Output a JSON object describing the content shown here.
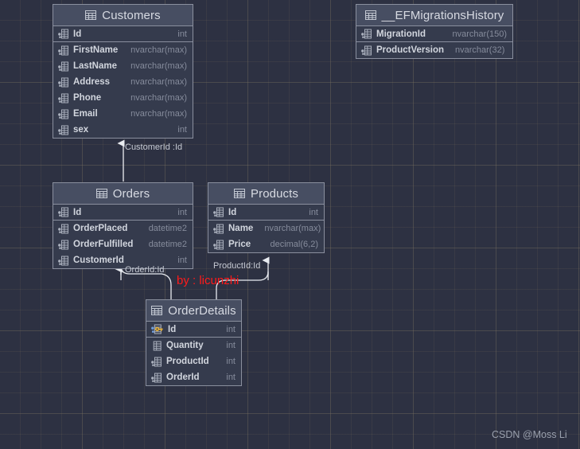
{
  "diagram": {
    "background_color": "#2d3142",
    "table_header_color": "#474e62",
    "table_body_color": "#353b4d",
    "border_color": "#8a8f9e",
    "accent_key_color": "#e8b339"
  },
  "tables": [
    {
      "id": "customers",
      "name": "Customers",
      "icon": "table-icon",
      "columns": [
        {
          "name": "Id",
          "type": "int",
          "icon": "column-icon",
          "primary": false
        },
        {
          "name": "FirstName",
          "type": "nvarchar(max)",
          "icon": "column-icon",
          "primary": false
        },
        {
          "name": "LastName",
          "type": "nvarchar(max)",
          "icon": "column-icon",
          "primary": false
        },
        {
          "name": "Address",
          "type": "nvarchar(max)",
          "icon": "column-icon",
          "primary": false
        },
        {
          "name": "Phone",
          "type": "nvarchar(max)",
          "icon": "column-icon",
          "primary": false
        },
        {
          "name": "Email",
          "type": "nvarchar(max)",
          "icon": "column-icon",
          "primary": false
        },
        {
          "name": "sex",
          "type": "int",
          "icon": "column-icon",
          "primary": false
        }
      ]
    },
    {
      "id": "efmigrations",
      "name": "__EFMigrationsHistory",
      "icon": "table-icon",
      "columns": [
        {
          "name": "MigrationId",
          "type": "nvarchar(150)",
          "icon": "column-icon",
          "primary": false
        },
        {
          "name": "ProductVersion",
          "type": "nvarchar(32)",
          "icon": "column-icon",
          "primary": false
        }
      ]
    },
    {
      "id": "orders",
      "name": "Orders",
      "icon": "table-icon",
      "columns": [
        {
          "name": "Id",
          "type": "int",
          "icon": "column-icon",
          "primary": false
        },
        {
          "name": "OrderPlaced",
          "type": "datetime2",
          "icon": "column-icon",
          "primary": false
        },
        {
          "name": "OrderFulfilled",
          "type": "datetime2",
          "icon": "column-icon",
          "primary": false
        },
        {
          "name": "CustomerId",
          "type": "int",
          "icon": "column-icon",
          "primary": false
        }
      ]
    },
    {
      "id": "products",
      "name": "Products",
      "icon": "table-icon",
      "columns": [
        {
          "name": "Id",
          "type": "int",
          "icon": "column-icon",
          "primary": false
        },
        {
          "name": "Name",
          "type": "nvarchar(max)",
          "icon": "column-icon",
          "primary": false
        },
        {
          "name": "Price",
          "type": "decimal(6,2)",
          "icon": "column-icon",
          "primary": false
        }
      ]
    },
    {
      "id": "orderdetails",
      "name": "OrderDetails",
      "icon": "table-icon",
      "columns": [
        {
          "name": "Id",
          "type": "int",
          "icon": "primary-key-icon",
          "primary": true
        },
        {
          "name": "Quantity",
          "type": "int",
          "icon": "column-icon",
          "primary": false
        },
        {
          "name": "ProductId",
          "type": "int",
          "icon": "column-icon",
          "primary": false
        },
        {
          "name": "OrderId",
          "type": "int",
          "icon": "column-icon",
          "primary": false
        }
      ]
    }
  ],
  "relationships": [
    {
      "id": "orders-customers",
      "label": "CustomerId :Id",
      "from": "orders",
      "to": "customers"
    },
    {
      "id": "orderdetails-orders",
      "label": "OrderId:Id",
      "from": "orderdetails",
      "to": "orders"
    },
    {
      "id": "orderdetails-products",
      "label": "ProductId:Id",
      "from": "orderdetails",
      "to": "products"
    }
  ],
  "watermarks": {
    "author_red": "by : licunzhi",
    "site_credit": "CSDN @Moss Li"
  }
}
